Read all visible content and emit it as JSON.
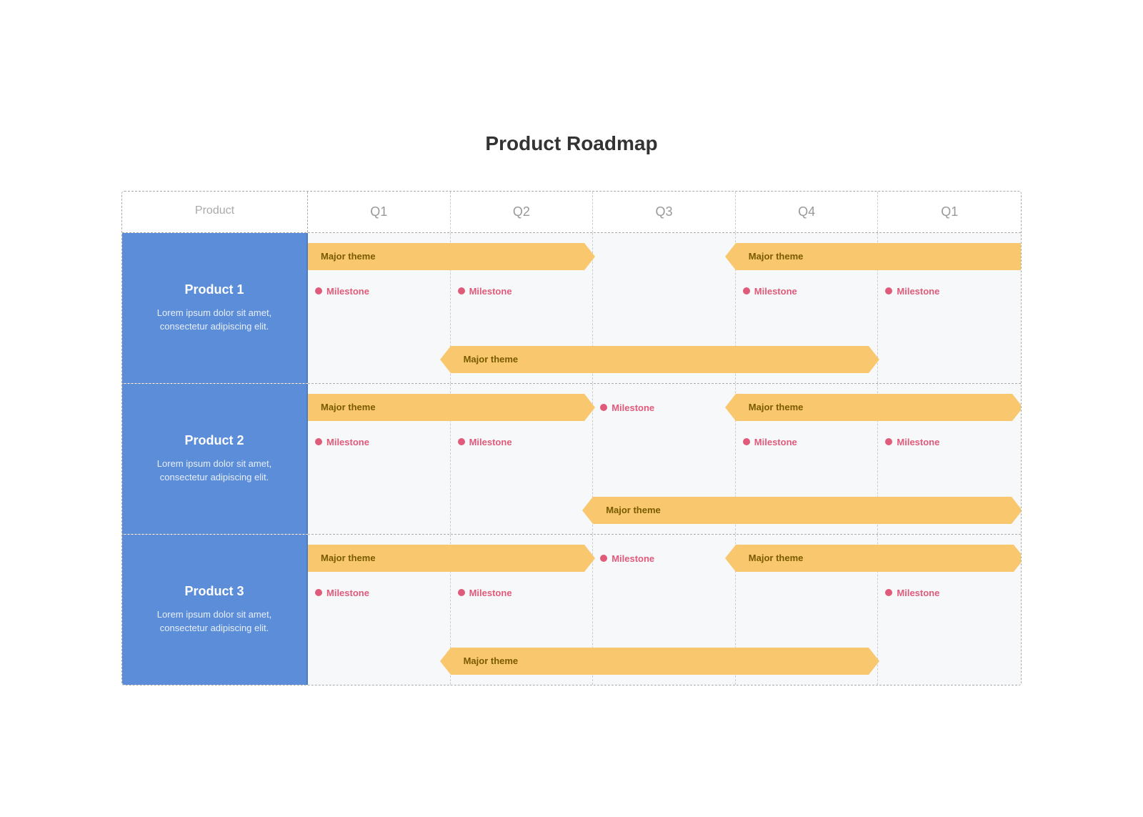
{
  "title": "Product Roadmap",
  "header": {
    "product_label": "Product",
    "quarters": [
      "Q1",
      "Q2",
      "Q3",
      "Q4",
      "Q1"
    ]
  },
  "products": [
    {
      "name": "Product 1",
      "description": "Lorem ipsum dolor sit amet, consectetur adipiscing elit."
    },
    {
      "name": "Product 2",
      "description": "Lorem ipsum dolor sit amet, consectetur adipiscing elit."
    },
    {
      "name": "Product 3",
      "description": "Lorem ipsum dolor sit amet, consectetur adipiscing elit."
    }
  ],
  "theme_label": "Major theme",
  "milestone_label": "Milestone",
  "accent_color": "#f9c86e",
  "milestone_color": "#e05a7a",
  "product_bg": "#5b8dd9"
}
